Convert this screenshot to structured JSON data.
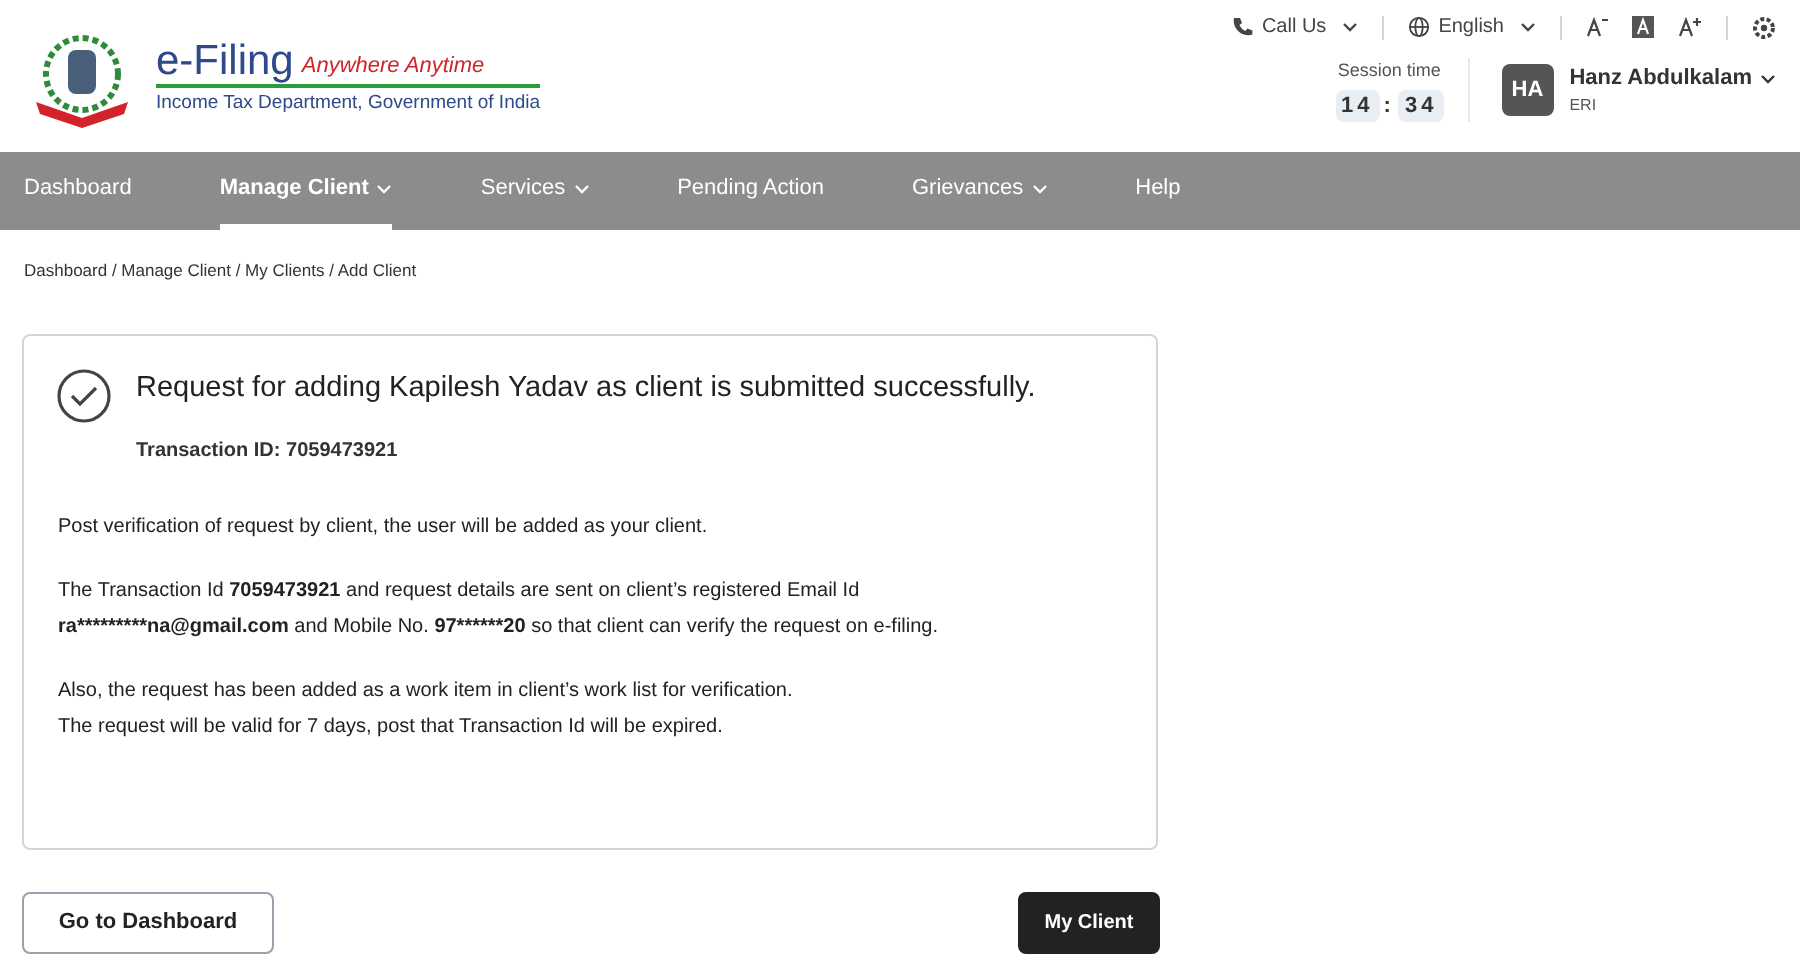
{
  "logo": {
    "title": "e-Filing",
    "tagline": "Anywhere Anytime",
    "department": "Income Tax Department, Government of India"
  },
  "utility": {
    "call": "Call Us",
    "language": "English"
  },
  "session": {
    "label": "Session time",
    "minutes": "14",
    "separator": ":",
    "seconds": "34"
  },
  "user": {
    "initials": "HA",
    "name": "Hanz Abdulkalam",
    "role": "ERI"
  },
  "nav": [
    {
      "label": "Dashboard",
      "selected": false,
      "dropdown": false
    },
    {
      "label": "Manage Client",
      "selected": true,
      "dropdown": true
    },
    {
      "label": "Services",
      "selected": false,
      "dropdown": true
    },
    {
      "label": "Pending Action",
      "selected": false,
      "dropdown": false
    },
    {
      "label": "Grievances",
      "selected": false,
      "dropdown": true
    },
    {
      "label": "Help",
      "selected": false,
      "dropdown": false
    }
  ],
  "breadcrumb": "Dashboard / Manage Client / My Clients / Add Client",
  "card": {
    "heading": "Request for adding Kapilesh Yadav as client is submitted successfully.",
    "transaction": "Transaction ID: 7059473921",
    "paragraphs": [
      [
        [
          {
            "text": "Post verification of request by client, the user will be added as your client.",
            "bold": false
          }
        ]
      ],
      [
        [
          {
            "text": "The Transaction Id ",
            "bold": false
          },
          {
            "text": "7059473921",
            "bold": true
          },
          {
            "text": " and request details are sent on client’s registered Email Id",
            "bold": false
          }
        ],
        [
          {
            "text": "ra*********na@gmail.com",
            "bold": true
          },
          {
            "text": " and Mobile No. ",
            "bold": false
          },
          {
            "text": "97******20",
            "bold": true
          },
          {
            "text": " so that client can verify the request on e-filing.",
            "bold": false
          }
        ]
      ],
      [
        [
          {
            "text": "Also, the request has been added as a work item in client’s work list for verification.",
            "bold": false
          }
        ],
        [
          {
            "text": "The request will be valid for 7 days, post that Transaction Id will be expired.",
            "bold": false
          }
        ]
      ]
    ]
  },
  "buttons": {
    "secondary": "Go to Dashboard",
    "primary": "My Client"
  }
}
